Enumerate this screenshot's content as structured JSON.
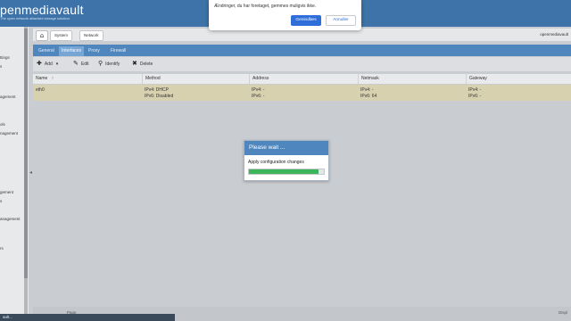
{
  "app": {
    "brand": "penmediavault",
    "tagline": "The open network attached storage solution"
  },
  "sidebar": {
    "items": [
      {
        "label": "ttings"
      },
      {
        "label": "s"
      },
      {
        "label": "agement"
      },
      {
        "label": "ols"
      },
      {
        "label": "nagement"
      },
      {
        "label": "gement"
      },
      {
        "label": "s"
      },
      {
        "label": "anagement"
      },
      {
        "label": "rs"
      }
    ]
  },
  "breadcrumb": {
    "items": [
      "System",
      "Network"
    ],
    "hostname": "openmediavault"
  },
  "tabs": [
    "General",
    "Interfaces",
    "Proxy",
    "Firewall"
  ],
  "toolbar": {
    "add": "Add",
    "edit": "Edit",
    "identify": "Identify",
    "delete": "Delete"
  },
  "grid": {
    "columns": [
      "Name",
      "Method",
      "Address",
      "Netmask",
      "Gateway"
    ],
    "row": {
      "name": "eth0",
      "method": [
        "IPv4: DHCP",
        "IPv6: Disabled"
      ],
      "address": [
        "IPv4: -",
        "IPv6: -"
      ],
      "netmask": [
        "IPv4: -",
        "IPv6: 64"
      ],
      "gateway": [
        "IPv4: -",
        "IPv6: -"
      ]
    }
  },
  "dialog": {
    "title": "Please wait ...",
    "message": "Apply configuration changes",
    "progress": 0.93
  },
  "alert": {
    "message": "Ændringer, du har foretaget, gemmes muligvis ikke.",
    "ok": "Genindlæs",
    "cancel": "Annuller"
  },
  "pager": {
    "page_label": "Page",
    "display": "Displ"
  },
  "status": {
    "text": "ault..."
  }
}
